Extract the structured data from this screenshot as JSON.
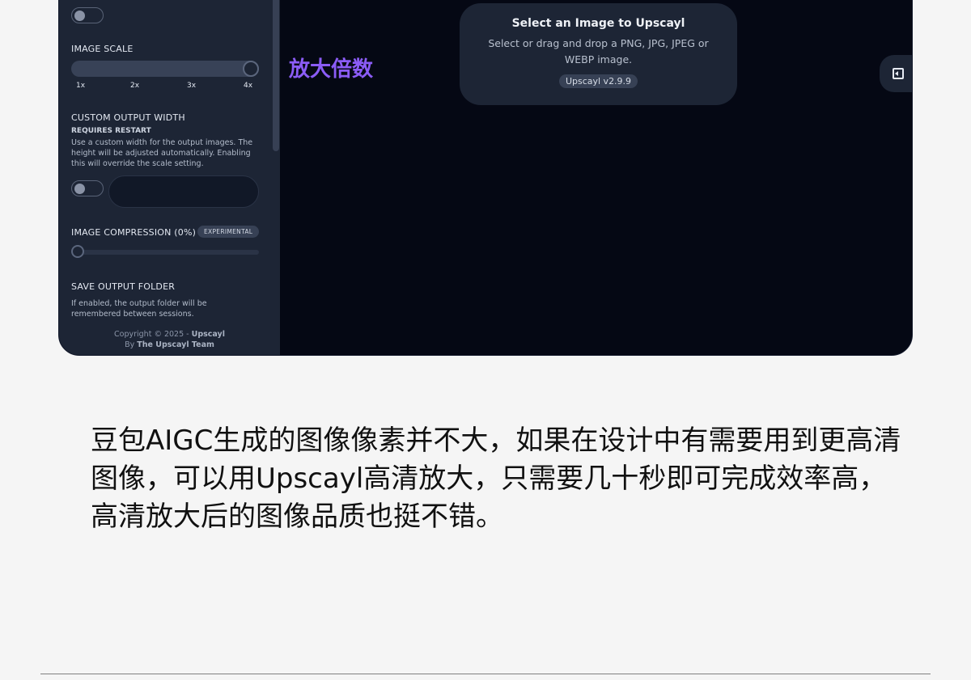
{
  "app": {
    "sidebar": {
      "image_scale": {
        "title": "IMAGE SCALE",
        "ticks": [
          "1x",
          "2x",
          "3x",
          "4x"
        ],
        "selected": "4x"
      },
      "custom_output_width": {
        "title": "CUSTOM OUTPUT WIDTH",
        "requires": "REQUIRES RESTART",
        "description": "Use a custom width for the output images. The height will be adjusted automatically. Enabling this will override the scale setting.",
        "enabled": false,
        "value": ""
      },
      "image_compression": {
        "title": "IMAGE COMPRESSION (0%)",
        "badge": "EXPERIMENTAL",
        "value": 0
      },
      "save_output_folder": {
        "title": "SAVE OUTPUT FOLDER",
        "description": "If enabled, the output folder will be remembered between sessions."
      },
      "footer": {
        "copyright": "Copyright © 2025 - ",
        "brand": "Upscayl",
        "by": "By ",
        "team": "The Upscayl Team"
      }
    },
    "drop_zone": {
      "title": "Select an Image to Upscayl",
      "subtitle": "Select or drag and drop a PNG, JPG, JPEG or WEBP image.",
      "version": "Upscayl v2.9.9"
    }
  },
  "annotation": "放大倍数",
  "article": {
    "text": "豆包AIGC生成的图像像素并不大，如果在设计中有需要用到更高清图像，可以用Upscayl高清放大，只需要几十秒即可完成效率高，高清放大后的图像品质也挺不错。"
  },
  "colors": {
    "accent": "#8b5cf6",
    "sidebar_bg": "#1d2535",
    "main_bg": "#050814"
  }
}
